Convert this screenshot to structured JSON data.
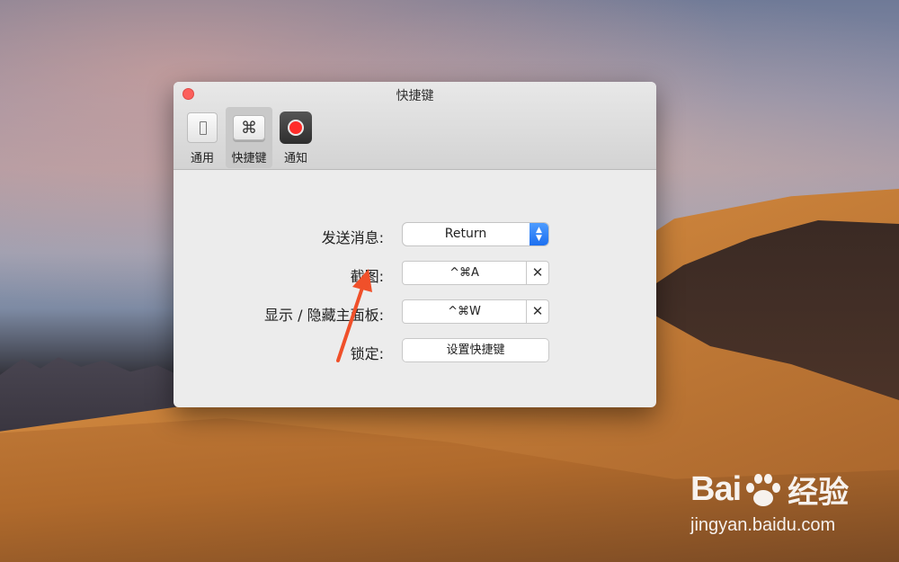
{
  "window": {
    "title": "快捷键"
  },
  "toolbar": {
    "items": [
      {
        "label": "通用",
        "icon": "general-switch-icon",
        "active": false
      },
      {
        "label": "快捷键",
        "icon": "command-key-icon",
        "glyph": "⌘",
        "active": true
      },
      {
        "label": "通知",
        "icon": "record-dot-icon",
        "active": false
      }
    ]
  },
  "settings": {
    "send_message": {
      "label": "发送消息:",
      "value": "Return"
    },
    "screenshot": {
      "label": "截图:",
      "value": "^⌘A",
      "clear": "✕"
    },
    "toggle_panel": {
      "label": "显示 / 隐藏主面板:",
      "value": "^⌘W",
      "clear": "✕"
    },
    "lock": {
      "label": "锁定:",
      "button": "设置快捷键"
    }
  },
  "watermark": {
    "brand": "Bai",
    "brand_suffix": "经验",
    "url": "jingyan.baidu.com"
  },
  "colors": {
    "accent": "#1c6ff0",
    "close": "#fc605c",
    "annotation_arrow": "#f0502a"
  }
}
